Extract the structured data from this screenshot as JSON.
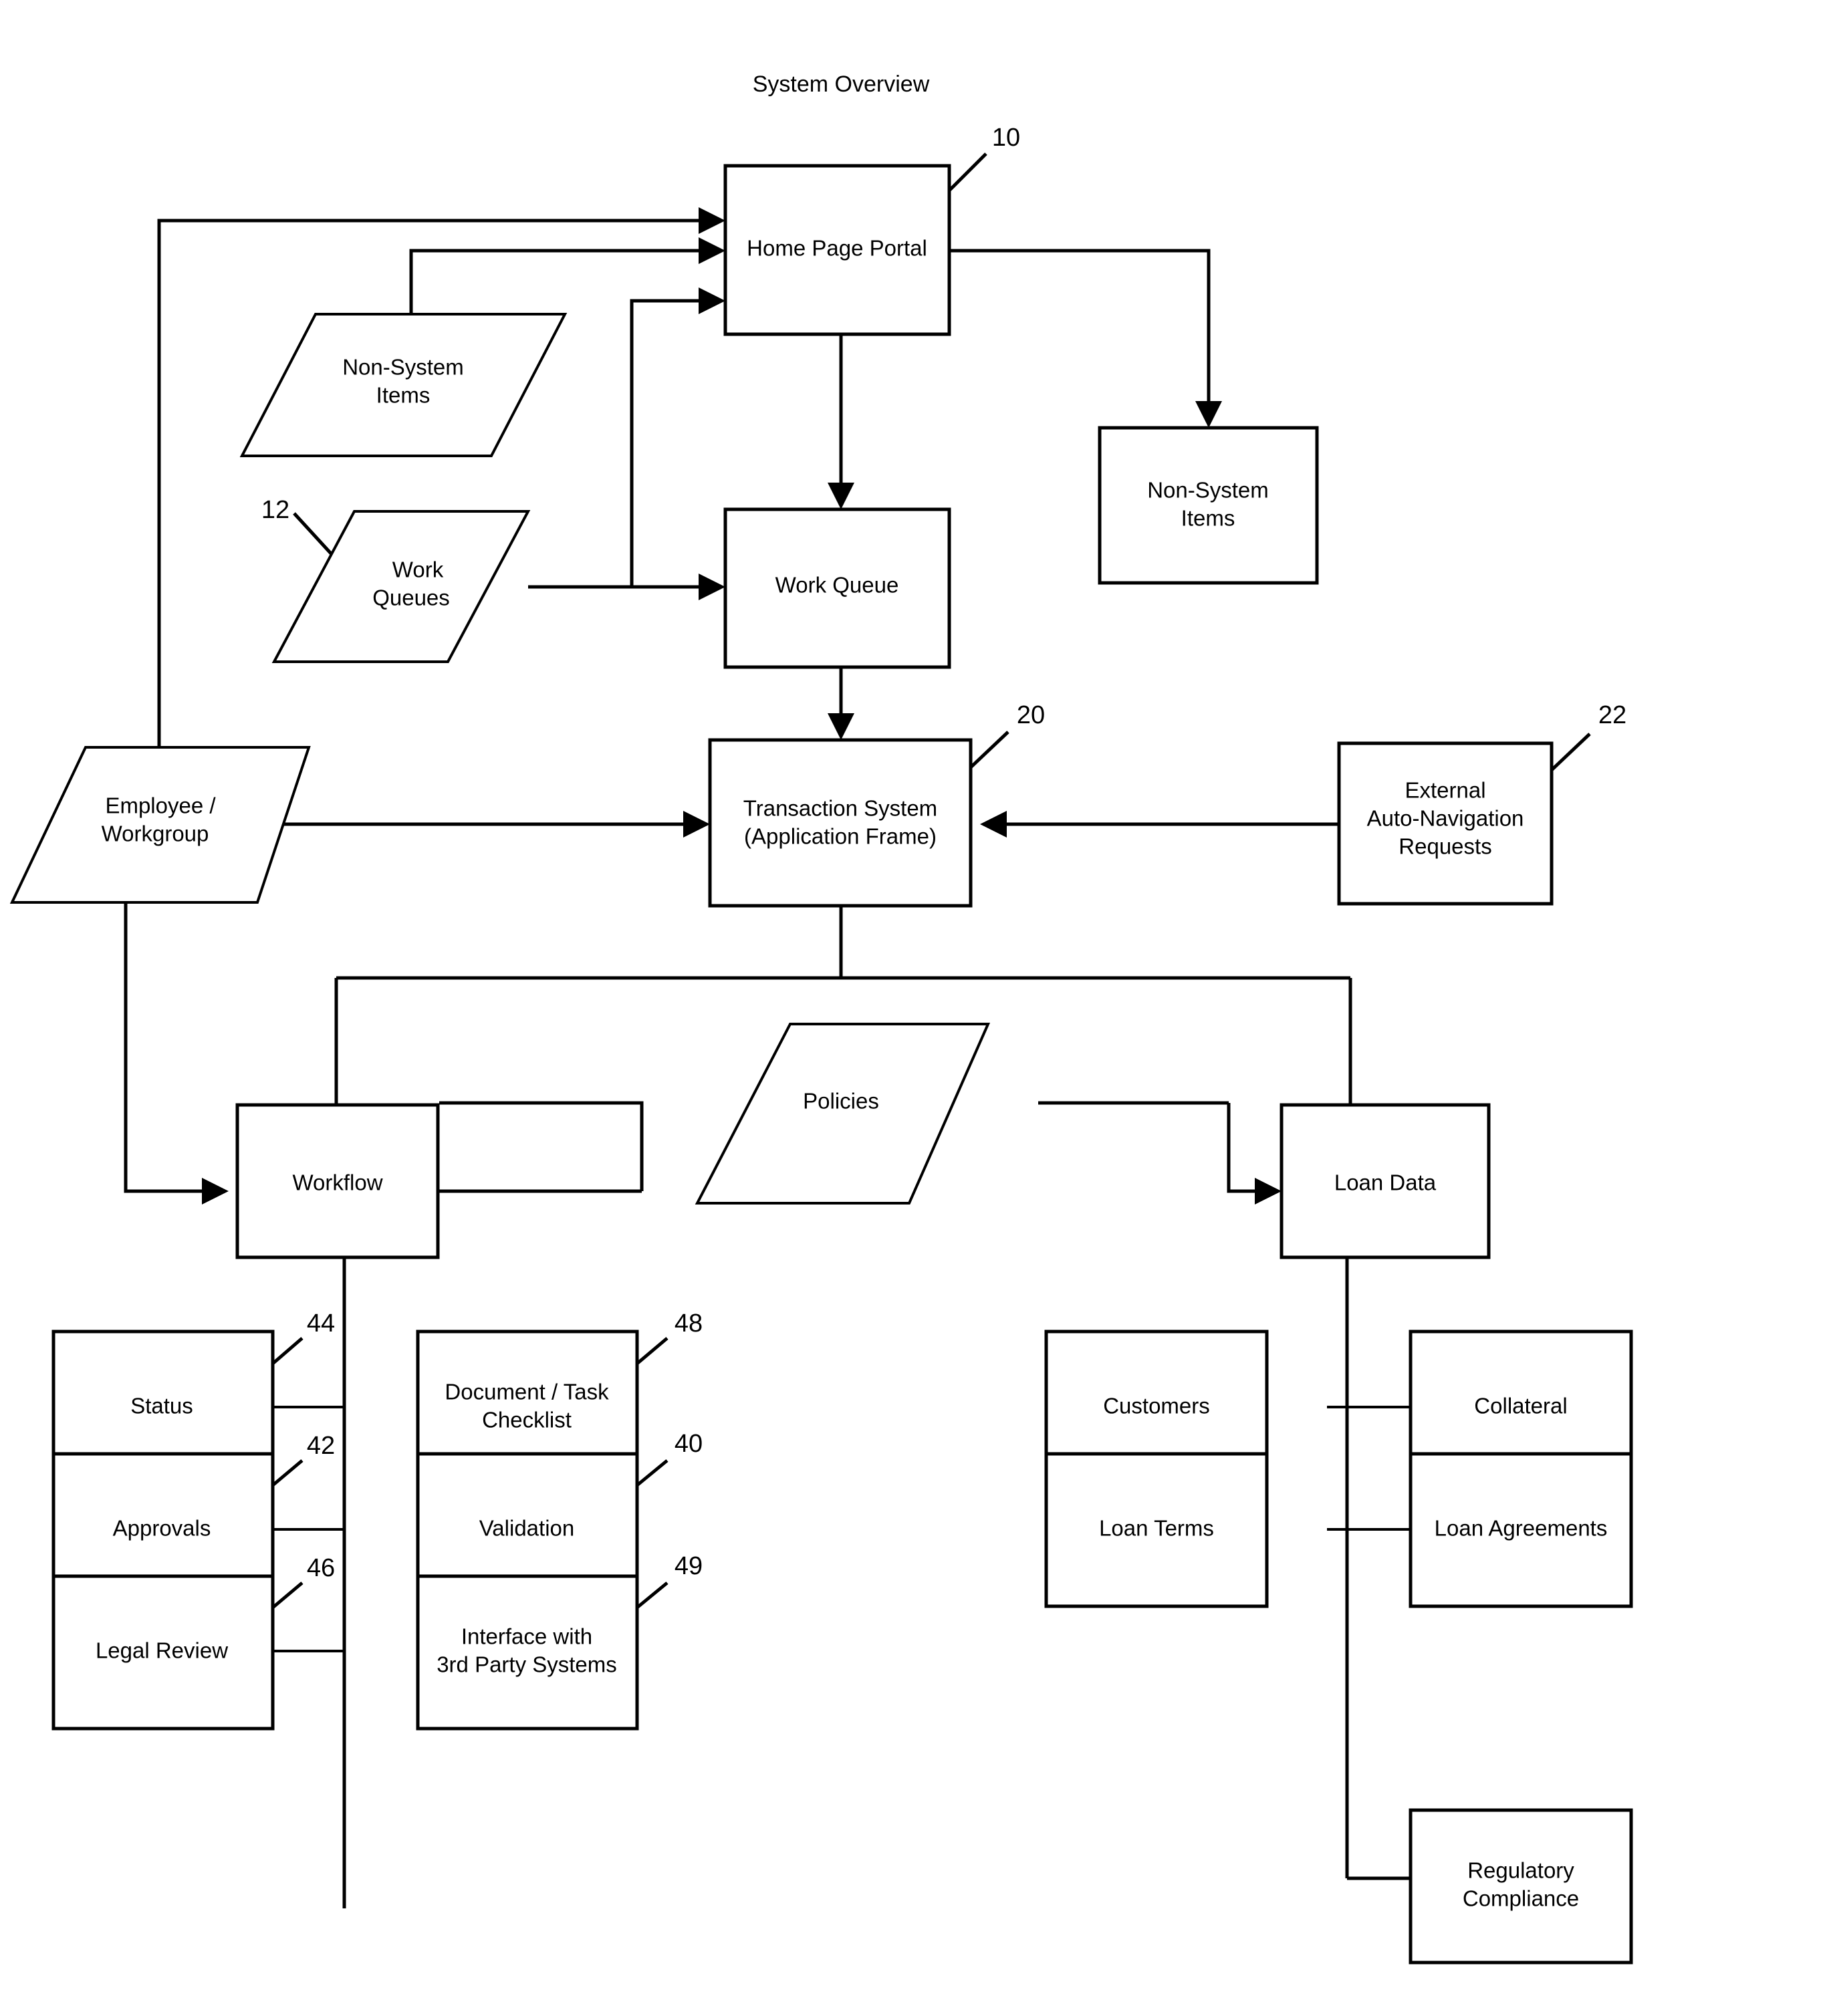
{
  "title": "System Overview",
  "nodes": {
    "home_page_portal": {
      "label": "Home Page Portal",
      "ref": "10",
      "shape": "rect"
    },
    "non_system_items_left": {
      "label_line1": "Non-System",
      "label_line2": "Items",
      "shape": "parallelogram"
    },
    "work_queues": {
      "label_line1": "Work",
      "label_line2": "Queues",
      "ref": "12",
      "shape": "parallelogram"
    },
    "work_queue": {
      "label": "Work Queue",
      "shape": "rect"
    },
    "non_system_items_right": {
      "label_line1": "Non-System",
      "label_line2": "Items",
      "shape": "rect"
    },
    "employee_workgroup": {
      "label_line1": "Employee /",
      "label_line2": "Workgroup",
      "shape": "parallelogram"
    },
    "transaction_system": {
      "label_line1": "Transaction System",
      "label_line2": "(Application Frame)",
      "ref": "20",
      "shape": "rect"
    },
    "external_auto_navigation": {
      "label_line1": "External",
      "label_line2": "Auto-Navigation",
      "label_line3": "Requests",
      "ref": "22",
      "shape": "rect"
    },
    "workflow": {
      "label": "Workflow",
      "shape": "rect"
    },
    "policies": {
      "label": "Policies",
      "shape": "parallelogram"
    },
    "loan_data": {
      "label": "Loan Data",
      "shape": "rect"
    },
    "status": {
      "label": "Status",
      "ref": "44",
      "shape": "rect"
    },
    "document_task_checklist": {
      "label_line1": "Document / Task",
      "label_line2": "Checklist",
      "ref": "48",
      "shape": "rect"
    },
    "approvals": {
      "label": "Approvals",
      "ref": "42",
      "shape": "rect"
    },
    "validation": {
      "label": "Validation",
      "ref": "40",
      "shape": "rect"
    },
    "legal_review": {
      "label": "Legal Review",
      "ref": "46",
      "shape": "rect"
    },
    "interface_3rd_party": {
      "label_line1": "Interface with",
      "label_line2": "3rd Party Systems",
      "ref": "49",
      "shape": "rect"
    },
    "customers": {
      "label": "Customers",
      "shape": "rect"
    },
    "collateral": {
      "label": "Collateral",
      "shape": "rect"
    },
    "loan_terms": {
      "label": "Loan Terms",
      "shape": "rect"
    },
    "loan_agreements": {
      "label": "Loan Agreements",
      "shape": "rect"
    },
    "regulatory_compliance": {
      "label_line1": "Regulatory",
      "label_line2": "Compliance",
      "shape": "rect"
    }
  },
  "colors": {
    "stroke": "#000000",
    "fill": "#ffffff",
    "background": "#ffffff"
  }
}
